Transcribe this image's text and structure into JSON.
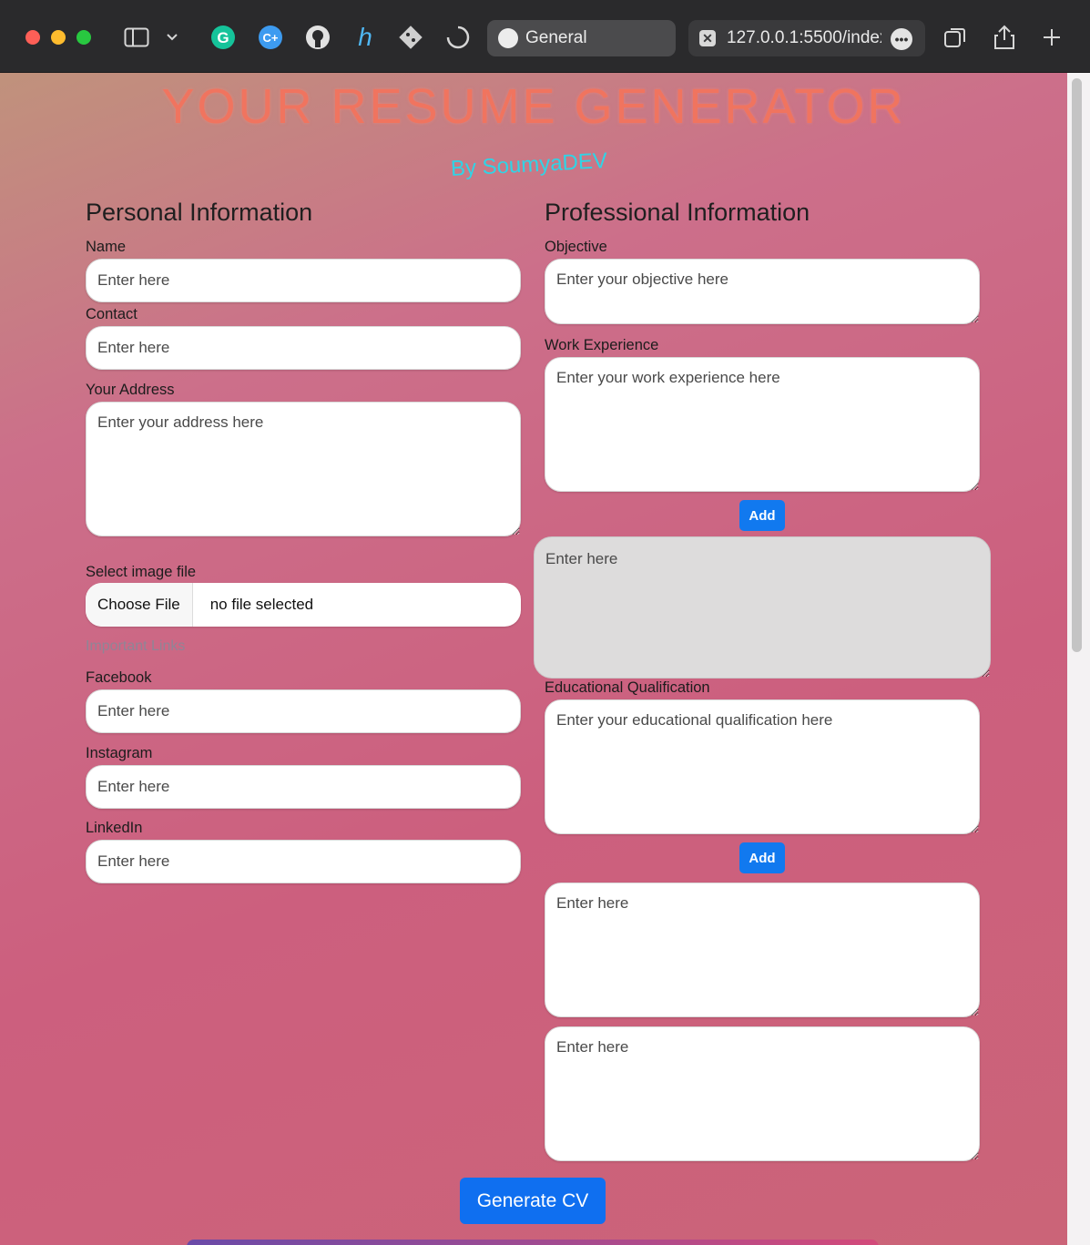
{
  "browser": {
    "tabs": [
      {
        "label": "General"
      },
      {
        "label": "127.0.0.1:5500/index.html"
      }
    ]
  },
  "page": {
    "title": "YOUR RESUME GENERATOR",
    "byline": "By SoumyaDEV",
    "personal": {
      "heading": "Personal Information",
      "name_label": "Name",
      "name_placeholder": "Enter here",
      "contact_label": "Contact",
      "contact_placeholder": "Enter here",
      "address_label": "Your Address",
      "address_placeholder": "Enter your address here",
      "image_label": "Select image file",
      "file_button": "Choose File",
      "file_status": "no file selected",
      "links_heading": "Important Links",
      "facebook_label": "Facebook",
      "facebook_placeholder": "Enter here",
      "instagram_label": "Instagram",
      "instagram_placeholder": "Enter here",
      "linkedin_label": "LinkedIn",
      "linkedin_placeholder": "Enter here"
    },
    "professional": {
      "heading": "Professional Information",
      "objective_label": "Objective",
      "objective_placeholder": "Enter your objective here",
      "work_label": "Work Experience",
      "work_placeholder": "Enter your work experience here",
      "add_label": "Add",
      "extra_work_placeholder": "Enter here",
      "edu_label": "Educational Qualification",
      "edu_placeholder": "Enter your educational qualification here",
      "extra_edu_placeholders": [
        "Enter here",
        "Enter here"
      ]
    },
    "generate_label": "Generate CV"
  },
  "colors": {
    "title": "#f0745f",
    "byline": "#2fd4e6",
    "button": "#1179ef"
  }
}
